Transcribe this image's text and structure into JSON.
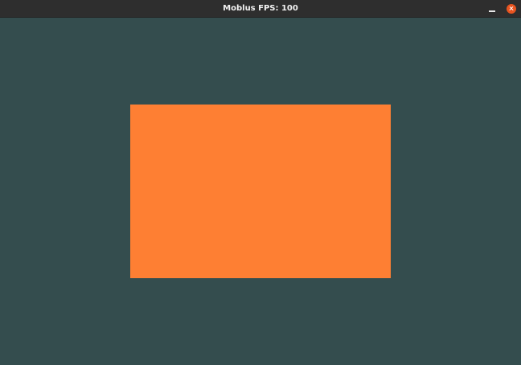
{
  "window": {
    "title": "Moblus FPS: 100",
    "background_color": "#344d4e"
  },
  "controls": {
    "minimize_icon": "minimize-icon",
    "close_icon": "close-icon",
    "close_color": "#e95420"
  },
  "scene": {
    "quad_color": "#fe7f33"
  }
}
